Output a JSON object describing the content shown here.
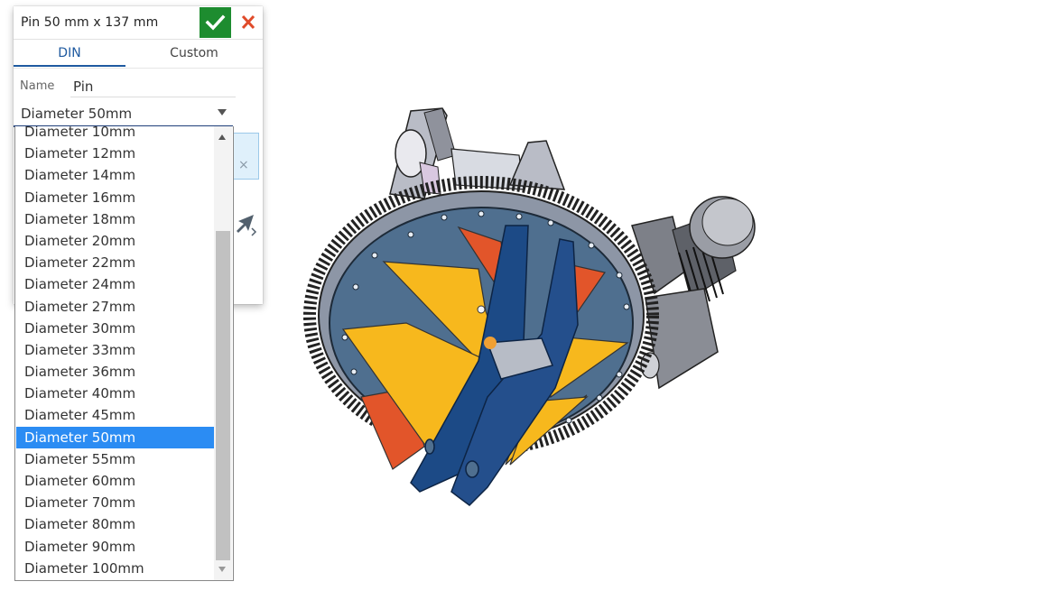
{
  "dialog": {
    "title": "Pin 50 mm x 137 mm",
    "ok_icon": "check-icon",
    "cancel_icon": "close-icon",
    "tabs": [
      {
        "label": "DIN",
        "active": true
      },
      {
        "label": "Custom",
        "active": false
      }
    ],
    "name_label": "Name",
    "name_value": "Pin",
    "size_select_value": "Diameter 50mm",
    "selection_clear_symbol": "×",
    "arrow_tool_icon": "arrow-cursor-icon"
  },
  "dropdown": {
    "options": [
      "Diameter 10mm",
      "Diameter 12mm",
      "Diameter 14mm",
      "Diameter 16mm",
      "Diameter 18mm",
      "Diameter 20mm",
      "Diameter 22mm",
      "Diameter 24mm",
      "Diameter 27mm",
      "Diameter 30mm",
      "Diameter 33mm",
      "Diameter 36mm",
      "Diameter 40mm",
      "Diameter 45mm",
      "Diameter 50mm",
      "Diameter 55mm",
      "Diameter 60mm",
      "Diameter 70mm",
      "Diameter 80mm",
      "Diameter 90mm",
      "Diameter 100mm"
    ],
    "selected": "Diameter 50mm"
  },
  "colors": {
    "accent": "#1f5aa0",
    "ok_green": "#1d8c2f",
    "cancel_red": "#e04b2a",
    "selection_blue": "#2b8cf3",
    "disc_blue": "#4f6f8f",
    "plate_navy": "#1c4a86",
    "fin_yellow": "#f7b81d",
    "fin_orange": "#e2552a"
  }
}
